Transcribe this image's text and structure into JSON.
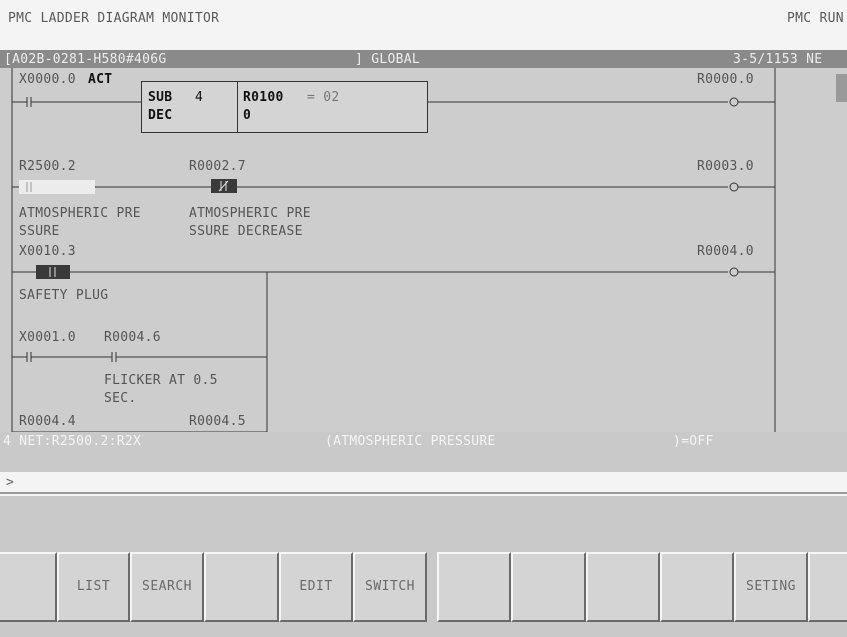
{
  "title": {
    "left": "PMC LADDER DIAGRAM MONITOR",
    "right": "PMC RUN"
  },
  "header": {
    "program": "[A02B-0281-H580#406G",
    "scope": "] GLOBAL",
    "position": "3-5/1153 NE"
  },
  "ladder": {
    "net1": {
      "contact": "X0000.0",
      "contact_tag": "ACT",
      "func_name": "SUB",
      "func_num": "4",
      "func_name2": "DEC",
      "func_param1": "R0100",
      "func_eq": "= 02",
      "func_param2": "0",
      "coil": "R0000.0"
    },
    "net2": {
      "contact1": "R2500.2",
      "contact2": "R0002.7",
      "coil": "R0003.0",
      "comment1a": "ATMOSPHERIC PRE",
      "comment1b": "SSURE",
      "comment2a": "ATMOSPHERIC PRE",
      "comment2b": "SSURE DECREASE"
    },
    "net3": {
      "contact1": "X0010.3",
      "coil": "R0004.0",
      "comment1": "SAFETY PLUG",
      "contact2": "X0001.0",
      "contact3": "R0004.6",
      "comment3a": "FLICKER AT 0.5",
      "comment3b": "SEC.",
      "contact4": "R0004.4",
      "contact5": "R0004.5"
    }
  },
  "status": {
    "net": "4 NET:R2500.2:R2X",
    "comment": "(ATMOSPHERIC PRESSURE",
    "value": ")=OFF"
  },
  "input": {
    "prompt": ">"
  },
  "softkeys": [
    "",
    "LIST",
    "SEARCH",
    "",
    "EDIT",
    "SWITCH",
    "",
    "",
    "",
    "",
    "SETING",
    ""
  ]
}
